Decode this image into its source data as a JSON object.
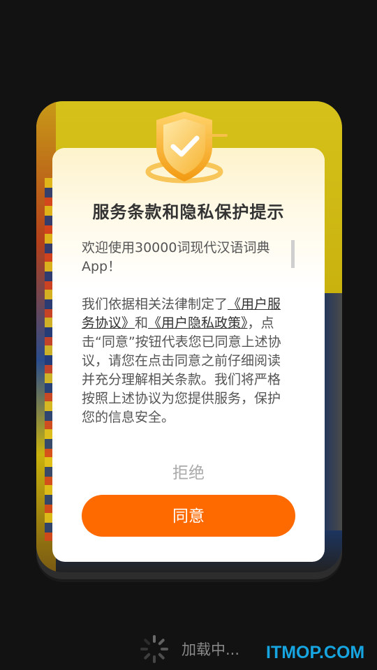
{
  "dialog": {
    "title": "服务条款和隐私保护提示",
    "welcome": "欢迎使用30000词现代汉语词典App！",
    "body_prefix": "我们依据相关法律制定了",
    "service_agreement_link": "《用户服务协议》",
    "and_text": "和",
    "privacy_policy_link": "《用户隐私政策》",
    "body_suffix": "，点击“同意”按钮代表您已同意上述协议，请您在点击同意之前仔细阅读并充分理解相关条款。我们将严格按照上述协议为您提供服务，保护您的信息安全。",
    "reject_label": "拒绝",
    "agree_label": "同意"
  },
  "loading": {
    "text": "加载中..."
  },
  "watermark": {
    "text": "ITMOP.COM"
  },
  "colors": {
    "accent": "#fe6a00",
    "watermark": "#16a5e0",
    "background": "#121212"
  }
}
